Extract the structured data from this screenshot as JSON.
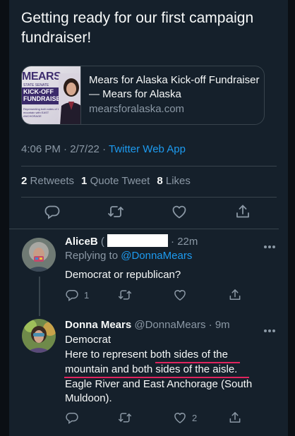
{
  "tweet": {
    "text": "Getting ready for our first campaign fundraiser!",
    "card": {
      "thumb_head": "MEARS",
      "thumb_sub": "STATE SENATE",
      "thumb_band": "KICK-OFF FUNDRAISER",
      "thumb_fine": "Representing both sides of the mountain with EAST ANCHORAGE",
      "title": "Mears for Alaska Kick-off Fundraiser — Mears for Alaska",
      "domain": "mearsforalaska.com"
    },
    "time": "4:06 PM · 2/7/22 · ",
    "app": "Twitter Web App",
    "retweets_count": "2",
    "retweets_label": "Retweets",
    "quotes_count": "1",
    "quotes_label": "Quote Tweet",
    "likes_count": "8",
    "likes_label": "Likes"
  },
  "reply1": {
    "name": "AliceB",
    "name_partial": "(",
    "time": "· 22m",
    "replying_prefix": "Replying to ",
    "replying_handle": "@DonnaMears",
    "text": "Democrat or republican?",
    "reply_count": "1"
  },
  "reply2": {
    "name": "Donna Mears",
    "handle": "@DonnaMears",
    "time": "· 9m",
    "line1": "Democrat",
    "line2a": "Here to represent ",
    "line2b": "both sides of the",
    "line3": "mountain and both sides of the aisle.",
    "line4": "Eagle River and East Anchorage (South",
    "line5": "Muldoon).",
    "like_count": "2"
  },
  "colors": {
    "background": "#15202b",
    "accent": "#1d9bf0",
    "muted": "#8b98a5",
    "underline": "#e0245e"
  },
  "icons": [
    "reply-icon",
    "retweet-icon",
    "like-icon",
    "share-icon",
    "more-icon"
  ]
}
